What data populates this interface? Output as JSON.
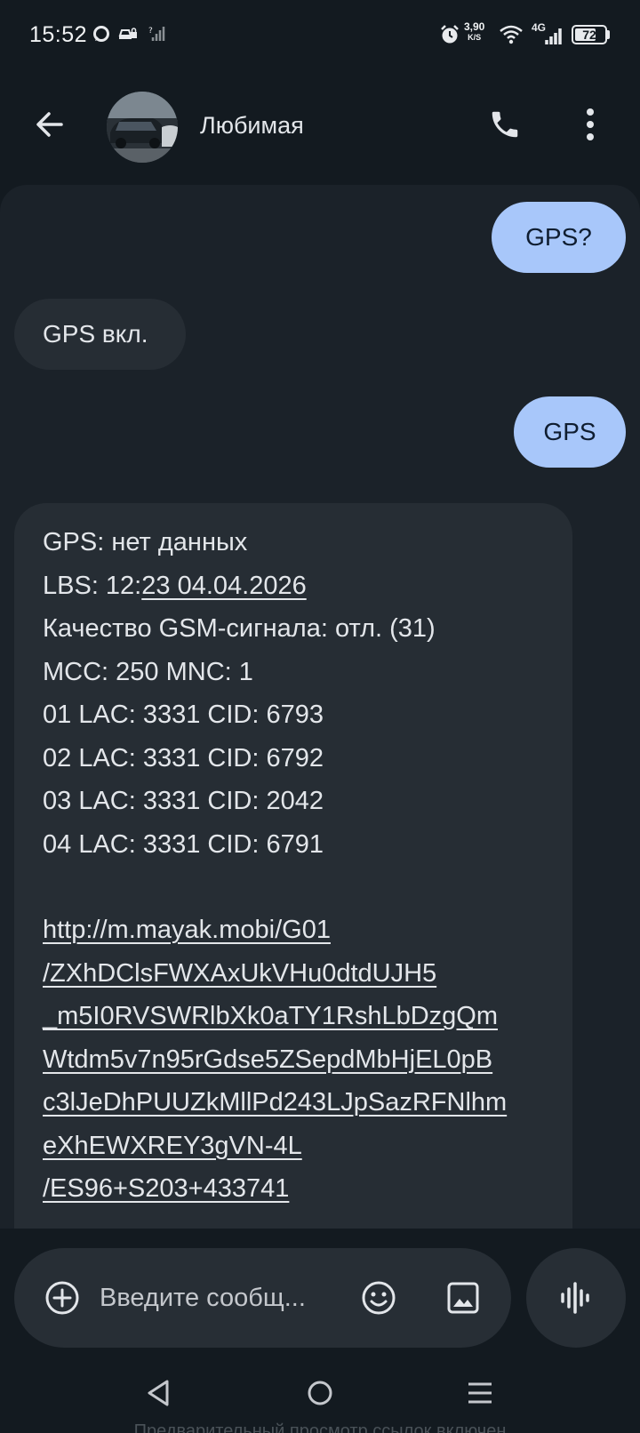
{
  "status_bar": {
    "time": "15:52",
    "net_speed_value": "3,90",
    "net_speed_unit": "K/S",
    "network_type": "4G",
    "battery_level": "72",
    "battery_fraction": 0.72,
    "icons": [
      "chat-bubble-icon",
      "car-lock-icon",
      "no-signal-icon",
      "alarm-icon",
      "wifi-icon",
      "signal-icon",
      "battery-icon"
    ]
  },
  "header": {
    "contact_name": "Любимая",
    "back_icon": "arrow-back-icon",
    "call_icon": "phone-icon",
    "menu_icon": "more-vert-icon"
  },
  "messages": [
    {
      "direction": "outgoing",
      "text": "GPS?"
    },
    {
      "direction": "incoming",
      "text": "GPS вкл."
    },
    {
      "direction": "outgoing",
      "text": "GPS"
    },
    {
      "direction": "incoming",
      "lines": {
        "l1": "GPS: нет данных",
        "l2_prefix": "LBS: 12:",
        "l2_link": "23 04.04.2026",
        "l3": "Качество GSM-сигнала: отл. (31)",
        "l4": "MCC: 250 MNC: 1",
        "l5": "01 LAC: 3331 CID: 6793",
        "l6": "02 LAC: 3331 CID: 6792",
        "l7": "03 LAC: 3331 CID: 2042",
        "l8": "04 LAC: 3331 CID: 6791"
      },
      "link_lines": [
        "http://m.mayak.mobi/G01",
        "/ZXhDClsFWXAxUkVHu0dtdUJH5",
        "_m5I0RVSWRlbXk0aTY1RshLbDzgQm",
        "Wtdm5v7n95rGdse5ZSepdMbHjEL0pB",
        "c3lJeDhPUUZkMllPd243LJpSazRFNlhm",
        "eXhEWXREY3gVN-4L",
        "/ES96+S203+433741"
      ]
    }
  ],
  "composer": {
    "placeholder": "Введите сообщ...",
    "plus_icon": "add-circle-icon",
    "emoji_icon": "emoji-icon",
    "gallery_icon": "image-icon",
    "voice_icon": "voice-waveform-icon"
  },
  "nav": {
    "back_icon": "nav-back-icon",
    "home_icon": "nav-home-icon",
    "recents_icon": "nav-menu-icon"
  },
  "footer_caption": "Предварительный просмотр ссылок включен",
  "colors": {
    "background": "#131a20",
    "panel": "#1b2229",
    "incoming_bubble": "#262d34",
    "outgoing_bubble": "#a8c7fa"
  }
}
